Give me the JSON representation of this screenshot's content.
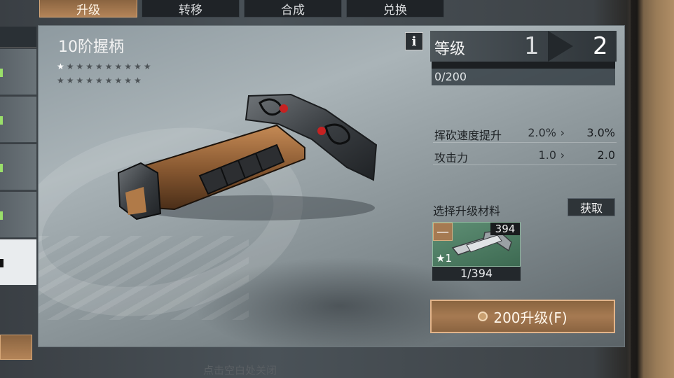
{
  "tabs": [
    {
      "label": "升级",
      "active": true
    },
    {
      "label": "转移",
      "active": false
    },
    {
      "label": "合成",
      "active": false
    },
    {
      "label": "兑换",
      "active": false
    }
  ],
  "item": {
    "name": "10阶握柄",
    "stars_row1": "★★★★★★★★★",
    "stars_filled": 1,
    "stars_row2": "★★★★★★★★★"
  },
  "level": {
    "label": "等级",
    "from": "1",
    "to": "2",
    "xp_text": "0/200",
    "xp_fraction": 0.0
  },
  "stats": [
    {
      "name": "挥砍速度提升",
      "current": "2.0%",
      "next": "3.0%"
    },
    {
      "name": "攻击力",
      "current": "1.0",
      "next": "2.0"
    }
  ],
  "materials": {
    "label": "选择升级材料",
    "get_button": "获取",
    "slot": {
      "minus": "—",
      "count": "394",
      "star_label": "★1",
      "selected": "1/394"
    }
  },
  "upgrade_button": {
    "coin_icon": "coin-g-icon",
    "label": "200升级(F)"
  },
  "info_button": "i",
  "close_hint": "点击空白处关闭",
  "colors": {
    "accent": "#b48458",
    "xp_fill": "#e0a050",
    "slot_bg": "#4f7e63"
  }
}
